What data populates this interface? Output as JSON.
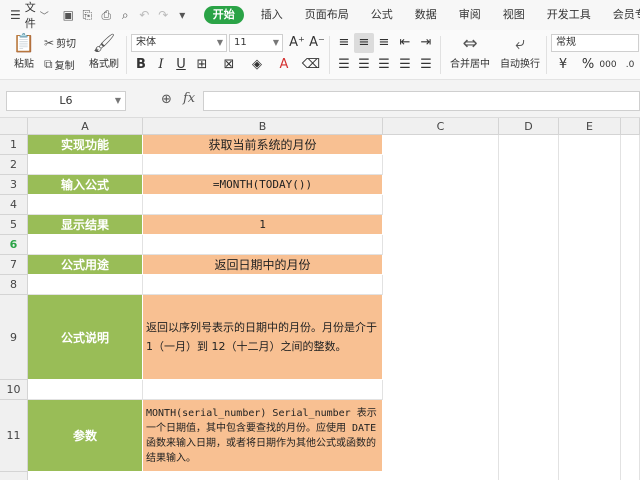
{
  "menubar": {
    "file_label": "文件",
    "tabs": [
      "开始",
      "插入",
      "页面布局",
      "公式",
      "数据",
      "审阅",
      "视图",
      "开发工具",
      "会员专享"
    ],
    "active_tab": "开始"
  },
  "ribbon": {
    "paste": "粘贴",
    "cut": "剪切",
    "copy": "复制",
    "format_painter": "格式刷",
    "font_name": "宋体",
    "font_size": "11",
    "merge_center": "合并居中",
    "wrap_text": "自动换行",
    "number_format": "常规"
  },
  "formula_bar": {
    "name_box": "L6",
    "fx": "fx",
    "formula": ""
  },
  "grid": {
    "columns": [
      "A",
      "B",
      "C",
      "D",
      "E"
    ],
    "rows": [
      "1",
      "2",
      "3",
      "4",
      "5",
      "6",
      "7",
      "8",
      "9",
      "10",
      "11"
    ],
    "active_row": "6",
    "cells": {
      "a1": "实现功能",
      "b1": "获取当前系统的月份",
      "a3": "输入公式",
      "b3": "=MONTH(TODAY())",
      "a5": "显示结果",
      "b5": "1",
      "a7": "公式用途",
      "b7": "返回日期中的月份",
      "a9": "公式说明",
      "b9": "返回以序列号表示的日期中的月份。月份是介于 1（一月）到 12（十二月）之间的整数。",
      "a11": "参数",
      "b11": "MONTH(serial_number) Serial_number 表示一个日期值，其中包含要查找的月份。应使用 DATE 函数来输入日期，或者将日期作为其他公式或函数的结果输入。"
    }
  },
  "colors": {
    "active_tab": "#2aa346",
    "label_fill": "#99bd57",
    "value_fill": "#f8c092"
  }
}
